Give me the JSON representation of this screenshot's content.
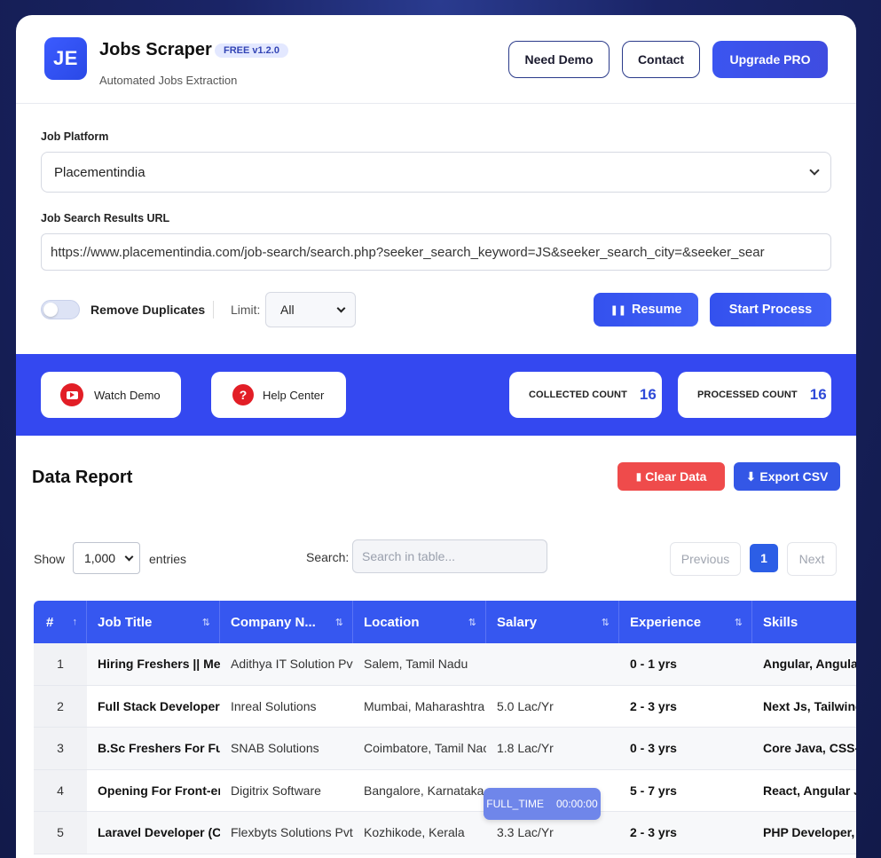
{
  "header": {
    "logo_text": "JE",
    "title": "Jobs Scraper",
    "version": "FREE v1.2.0",
    "subtitle": "Automated Jobs Extraction",
    "need_demo": "Need Demo",
    "contact": "Contact",
    "upgrade": "Upgrade PRO"
  },
  "form": {
    "platform_label": "Job Platform",
    "platform_value": "Placementindia",
    "url_label": "Job Search Results URL",
    "url_value": "https://www.placementindia.com/job-search/search.php?seeker_search_keyword=JS&seeker_search_city=&seeker_sear",
    "remove_duplicates": "Remove Duplicates",
    "limit_label": "Limit:",
    "limit_value": "All",
    "resume": "Resume",
    "start": "Start Process"
  },
  "band": {
    "watch_demo": "Watch Demo",
    "help_center": "Help Center",
    "collected_label": "COLLECTED COUNT",
    "collected_value": "16",
    "processed_label": "PROCESSED COUNT",
    "processed_value": "16"
  },
  "report": {
    "title": "Data Report",
    "clear": "Clear Data",
    "export": "Export CSV",
    "show": "Show",
    "entries_value": "1,000",
    "entries": "entries",
    "search_label": "Search:",
    "search_placeholder": "Search in table...",
    "previous": "Previous",
    "page": "1",
    "next": "Next"
  },
  "table": {
    "headers": [
      "#",
      "Job Title",
      "Company N...",
      "Location",
      "Salary",
      "Experience",
      "Skills"
    ],
    "rows": [
      [
        "1",
        "Hiring Freshers || Mer",
        "Adithya IT Solution Pvt",
        "Salem, Tamil Nadu",
        "",
        "0 - 1 yrs",
        "Angular, Angular"
      ],
      [
        "2",
        "Full Stack Developer -",
        "Inreal Solutions",
        "Mumbai, Maharashtra",
        "5.0 Lac/Yr",
        "2 - 3 yrs",
        "Next Js, Tailwind"
      ],
      [
        "3",
        "B.Sc Freshers For Full",
        "SNAB Solutions",
        "Coimbatore, Tamil Nac",
        "1.8 Lac/Yr",
        "0 - 3 yrs",
        "Core Java, CSS-C"
      ],
      [
        "4",
        "Opening For Front-en",
        "Digitrix Software",
        "Bangalore, Karnataka",
        "",
        "5 - 7 yrs",
        "React, Angular Js"
      ],
      [
        "5",
        "Laravel Developer (CR",
        "Flexbyts Solutions Pvt",
        "Kozhikode, Kerala",
        "3.3 Lac/Yr",
        "2 - 3 yrs",
        "PHP Developer, J"
      ]
    ]
  },
  "tooltip": {
    "type": "FULL_TIME",
    "time": "00:00:00"
  }
}
